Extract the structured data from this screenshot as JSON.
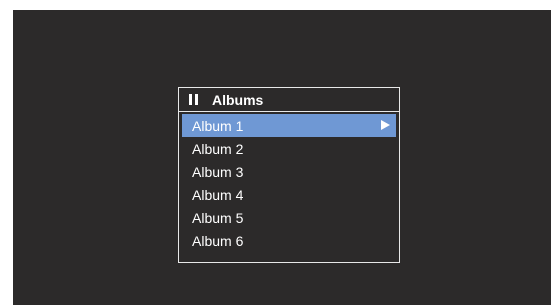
{
  "header": {
    "title": "Albums",
    "status_icon": "pause-icon"
  },
  "albums": [
    {
      "label": "Album 1",
      "selected": true,
      "indicator_icon": "play-arrow-icon"
    },
    {
      "label": "Album 2",
      "selected": false
    },
    {
      "label": "Album 3",
      "selected": false
    },
    {
      "label": "Album 4",
      "selected": false
    },
    {
      "label": "Album 5",
      "selected": false
    },
    {
      "label": "Album 6",
      "selected": false
    }
  ],
  "colors": {
    "screen_background": "#2c2a2a",
    "selection": "#6f98d4",
    "text": "#ffffff",
    "border": "#e8e8e8"
  }
}
